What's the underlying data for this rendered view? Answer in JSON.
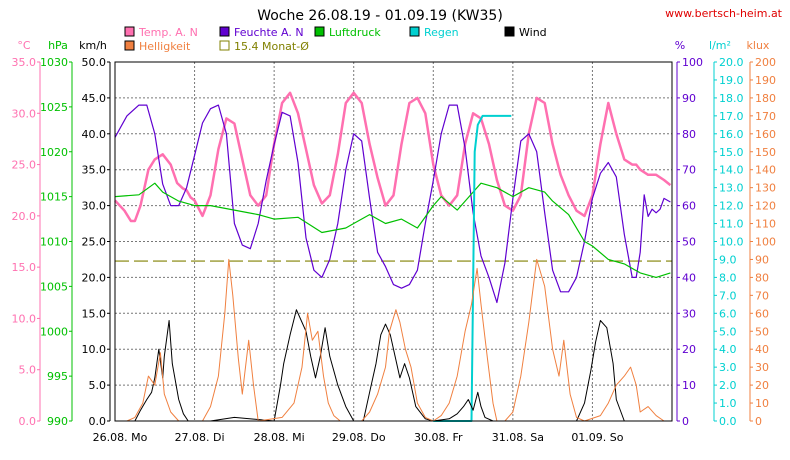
{
  "chart_data": {
    "type": "line",
    "title": "Woche 26.08.19 - 01.09.19 (KW35)",
    "source": "www.bertsch-heim.at",
    "x_labels": [
      "26.08.  Mo",
      "27.08.  Di",
      "28.08.  Mi",
      "29.08.  Do",
      "30.08.  Fr",
      "31.08.  Sa",
      "01.09.  So"
    ],
    "grid": true,
    "axes": {
      "temp": {
        "unit": "°C",
        "color": "#ff70b0",
        "min": 0,
        "max": 35,
        "step": 5,
        "decimals": 1,
        "side": "left"
      },
      "pressure": {
        "unit": "hPa",
        "color": "#00c000",
        "min": 990,
        "max": 1030,
        "step": 5,
        "decimals": 0,
        "side": "left"
      },
      "wind": {
        "unit": "km/h",
        "color": "#000000",
        "min": 0,
        "max": 50,
        "step": 5,
        "decimals": 1,
        "side": "left"
      },
      "humidity": {
        "unit": "%",
        "color": "#6000d0",
        "min": 0,
        "max": 100,
        "step": 10,
        "decimals": 0,
        "side": "right"
      },
      "rain": {
        "unit": "l/m²",
        "color": "#00d0d0",
        "min": 0,
        "max": 20,
        "step": 1,
        "decimals": 1,
        "side": "right"
      },
      "lux": {
        "unit": "klux",
        "color": "#f08040",
        "min": 0,
        "max": 200,
        "step": 10,
        "decimals": 0,
        "side": "right"
      }
    },
    "legend": [
      {
        "name": "Temp. A. N",
        "color": "#ff70b0",
        "style": "box"
      },
      {
        "name": "Feuchte A. N",
        "color": "#6000d0",
        "style": "box"
      },
      {
        "name": "Luftdruck",
        "color": "#00c000",
        "style": "box"
      },
      {
        "name": "Regen",
        "color": "#00d0d0",
        "style": "box"
      },
      {
        "name": "Wind",
        "color": "#000000",
        "style": "box"
      },
      {
        "name": "Helligkeit",
        "color": "#f08040",
        "style": "box"
      },
      {
        "name": "15.4 Monat-Ø",
        "color": "#808000",
        "style": "outline"
      }
    ],
    "series": [
      {
        "key": "temp",
        "axis": "temp",
        "color": "#ff70b0",
        "width": 2.5,
        "x": [
          0,
          0.12,
          0.2,
          0.25,
          0.32,
          0.42,
          0.5,
          0.6,
          0.7,
          0.78,
          0.85,
          0.9,
          0.95,
          1.0,
          1.1,
          1.2,
          1.3,
          1.4,
          1.5,
          1.6,
          1.7,
          1.8,
          1.9,
          2.0,
          2.1,
          2.2,
          2.3,
          2.4,
          2.5,
          2.6,
          2.7,
          2.8,
          2.9,
          3.0,
          3.1,
          3.2,
          3.3,
          3.4,
          3.5,
          3.6,
          3.7,
          3.8,
          3.9,
          4.0,
          4.1,
          4.2,
          4.3,
          4.4,
          4.5,
          4.6,
          4.7,
          4.8,
          4.9,
          5.0,
          5.1,
          5.2,
          5.3,
          5.4,
          5.5,
          5.6,
          5.7,
          5.8,
          5.9,
          6.0,
          6.1,
          6.2,
          6.3,
          6.4,
          6.5,
          6.55,
          6.6,
          6.7,
          6.8,
          6.9,
          6.98
        ],
        "y": [
          21.5,
          20.5,
          19.5,
          19.5,
          21,
          24.5,
          25.5,
          26,
          25,
          23.2,
          22.7,
          22.5,
          21.8,
          21.5,
          20,
          22,
          26.5,
          29.5,
          29,
          25.5,
          22,
          21,
          22,
          27,
          31,
          32,
          30,
          26.5,
          23,
          21.2,
          22,
          26,
          31,
          32,
          31,
          27,
          23.7,
          21,
          22,
          27,
          31,
          31.5,
          30,
          25,
          22,
          21,
          22,
          27,
          30,
          29.5,
          27,
          23.5,
          21,
          20.5,
          22,
          28,
          31.5,
          31,
          27,
          24,
          22,
          20.5,
          20,
          22,
          27,
          31,
          28,
          25.5,
          25,
          25,
          24.5,
          24,
          24,
          23.5,
          23
        ]
      },
      {
        "key": "humidity",
        "axis": "humidity",
        "color": "#6000d0",
        "width": 1.2,
        "x": [
          0,
          0.15,
          0.3,
          0.4,
          0.5,
          0.6,
          0.7,
          0.8,
          0.9,
          1.0,
          1.1,
          1.2,
          1.3,
          1.4,
          1.5,
          1.6,
          1.7,
          1.8,
          1.9,
          2.0,
          2.1,
          2.2,
          2.3,
          2.4,
          2.5,
          2.6,
          2.7,
          2.8,
          2.9,
          3.0,
          3.1,
          3.2,
          3.3,
          3.4,
          3.5,
          3.6,
          3.7,
          3.8,
          3.9,
          4.0,
          4.1,
          4.2,
          4.3,
          4.4,
          4.5,
          4.6,
          4.7,
          4.8,
          4.9,
          5.0,
          5.1,
          5.2,
          5.3,
          5.4,
          5.5,
          5.6,
          5.7,
          5.8,
          5.9,
          6.0,
          6.1,
          6.2,
          6.3,
          6.4,
          6.5,
          6.55,
          6.6,
          6.65,
          6.7,
          6.75,
          6.8,
          6.85,
          6.9,
          6.98
        ],
        "y": [
          79,
          85,
          88,
          88,
          80,
          66,
          60,
          60,
          65,
          74,
          83,
          87,
          88,
          80,
          55,
          49,
          48,
          55,
          67,
          77,
          86,
          85,
          72,
          51,
          42,
          40,
          45,
          55,
          70,
          80,
          78,
          62,
          47,
          43,
          38,
          37,
          38,
          42,
          55,
          67,
          80,
          88,
          88,
          76,
          58,
          46,
          40,
          33,
          44,
          62,
          78,
          80,
          75,
          58,
          42,
          36,
          36,
          40,
          50,
          62,
          69,
          72,
          68,
          52,
          40,
          40,
          47,
          63,
          57,
          59,
          58,
          59,
          62,
          61
        ]
      },
      {
        "key": "pressure",
        "axis": "pressure",
        "color": "#00c000",
        "width": 1.2,
        "x": [
          0,
          0.3,
          0.5,
          0.6,
          0.8,
          1.0,
          1.2,
          1.5,
          1.8,
          2.0,
          2.3,
          2.6,
          2.9,
          3.0,
          3.2,
          3.4,
          3.6,
          3.8,
          4.0,
          4.1,
          4.3,
          4.5,
          4.6,
          4.8,
          5.0,
          5.2,
          5.4,
          5.5,
          5.7,
          5.9,
          6.0,
          6.2,
          6.4,
          6.6,
          6.8,
          6.98
        ],
        "y": [
          1015,
          1015.2,
          1016.5,
          1015.5,
          1014.5,
          1014,
          1014,
          1013.5,
          1013,
          1012.5,
          1012.7,
          1011,
          1011.5,
          1012,
          1013,
          1012,
          1012.5,
          1011.5,
          1014,
          1015,
          1013.5,
          1015.5,
          1016.5,
          1016,
          1015,
          1016,
          1015.5,
          1014.5,
          1013,
          1010,
          1009.5,
          1008,
          1007.5,
          1006.5,
          1006,
          1006.5
        ]
      },
      {
        "key": "rain",
        "axis": "rain",
        "color": "#00d0d0",
        "width": 2,
        "x": [
          4.0,
          4.4,
          4.48,
          4.52,
          4.56,
          4.62,
          4.98
        ],
        "y": [
          0,
          0,
          0,
          15,
          16.5,
          17,
          17
        ]
      },
      {
        "key": "wind",
        "axis": "wind",
        "color": "#000000",
        "width": 1,
        "x": [
          0,
          0.15,
          0.25,
          0.32,
          0.4,
          0.46,
          0.5,
          0.55,
          0.6,
          0.62,
          0.68,
          0.72,
          0.8,
          0.86,
          0.92,
          1.0,
          1.2,
          1.5,
          2.0,
          2.08,
          2.12,
          2.2,
          2.28,
          2.34,
          2.4,
          2.46,
          2.52,
          2.58,
          2.64,
          2.7,
          2.8,
          2.9,
          3.0,
          3.12,
          3.2,
          3.28,
          3.34,
          3.4,
          3.46,
          3.52,
          3.58,
          3.64,
          3.7,
          3.78,
          3.9,
          4.0,
          4.2,
          4.3,
          4.38,
          4.44,
          4.5,
          4.56,
          4.6,
          4.65,
          4.75,
          4.9,
          5.2,
          5.5,
          5.8,
          5.9,
          5.98,
          6.04,
          6.1,
          6.18,
          6.26,
          6.3,
          6.4,
          6.5,
          6.9,
          6.98
        ],
        "y": [
          0,
          0,
          0,
          1.5,
          3,
          4,
          6,
          10,
          6,
          9,
          14,
          8,
          3,
          1,
          0,
          0,
          0,
          0.5,
          0,
          5,
          8,
          12,
          15.5,
          14,
          12.5,
          9,
          6,
          9,
          13,
          9,
          5,
          2,
          0,
          0,
          4,
          8,
          12,
          13.5,
          12,
          9,
          6,
          8,
          6,
          2,
          0.3,
          0,
          0.3,
          1,
          2,
          3,
          1.5,
          4,
          2,
          0.5,
          0,
          0,
          0,
          0,
          0,
          2.5,
          7,
          11,
          14,
          13,
          8,
          3,
          0,
          0,
          0,
          0
        ]
      },
      {
        "key": "lux",
        "axis": "lux",
        "color": "#f08040",
        "width": 1,
        "x": [
          0,
          0.15,
          0.25,
          0.35,
          0.42,
          0.5,
          0.57,
          0.62,
          0.7,
          0.8,
          0.9,
          1.0,
          1.1,
          1.2,
          1.3,
          1.38,
          1.43,
          1.48,
          1.55,
          1.6,
          1.68,
          1.74,
          1.8,
          2.1,
          2.25,
          2.35,
          2.42,
          2.48,
          2.55,
          2.62,
          2.68,
          2.75,
          2.83,
          2.9,
          3.1,
          3.2,
          3.3,
          3.4,
          3.45,
          3.53,
          3.58,
          3.65,
          3.72,
          3.8,
          3.9,
          4.0,
          4.1,
          4.2,
          4.3,
          4.4,
          4.48,
          4.55,
          4.6,
          4.68,
          4.75,
          4.8,
          4.9,
          5.0,
          5.1,
          5.2,
          5.3,
          5.4,
          5.5,
          5.58,
          5.64,
          5.72,
          5.8,
          5.9,
          6.1,
          6.2,
          6.3,
          6.4,
          6.48,
          6.55,
          6.6,
          6.7,
          6.8,
          6.9,
          6.98
        ],
        "y": [
          0,
          0,
          2,
          10,
          25,
          20,
          38,
          15,
          5,
          0,
          0,
          0,
          0,
          8,
          25,
          60,
          90,
          70,
          35,
          15,
          45,
          20,
          0,
          2,
          10,
          30,
          60,
          45,
          50,
          25,
          10,
          3,
          0,
          0,
          0,
          5,
          15,
          30,
          50,
          62,
          55,
          40,
          30,
          10,
          2,
          0,
          3,
          10,
          25,
          50,
          65,
          85,
          65,
          35,
          10,
          0,
          0,
          5,
          25,
          55,
          90,
          75,
          40,
          25,
          45,
          15,
          2,
          0,
          3,
          10,
          20,
          25,
          30,
          20,
          5,
          8,
          3,
          0,
          0
        ]
      }
    ],
    "reference_line": {
      "axis": "temp",
      "value": 15.4,
      "color": "#808000"
    }
  }
}
